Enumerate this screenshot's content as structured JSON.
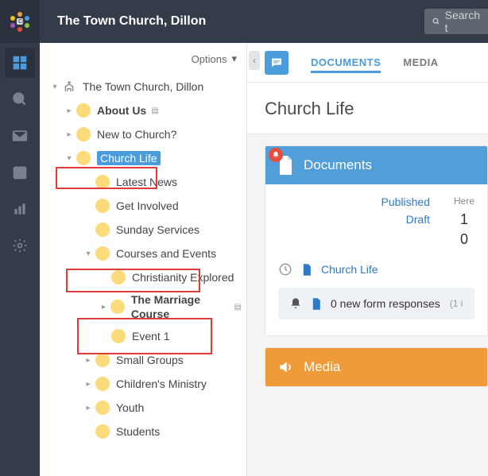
{
  "header": {
    "title": "The Town Church, Dillon",
    "search_placeholder": "Search t"
  },
  "sidebar": {
    "options_label": "Options",
    "root_label": "The Town Church, Dillon",
    "items": {
      "about": "About Us",
      "new": "New to Church?",
      "churchlife": "Church Life",
      "latest": "Latest News",
      "involved": "Get Involved",
      "sunday": "Sunday Services",
      "courses": "Courses and Events",
      "christianity": "Christianity Explored",
      "marriage": "The Marriage Course",
      "event1": "Event 1",
      "smallgroups": "Small Groups",
      "childrens": "Children's Ministry",
      "youth": "Youth",
      "students": "Students"
    }
  },
  "tabs": {
    "documents": "DOCUMENTS",
    "media": "MEDIA"
  },
  "page_title": "Church Life",
  "documents_panel": {
    "title": "Documents",
    "here_label": "Here",
    "published_label": "Published",
    "published_here": "1",
    "draft_label": "Draft",
    "draft_here": "0",
    "recent_item": "Church Life",
    "form_responses_text": "0 new form responses",
    "form_responses_muted": "(1 i"
  },
  "media_panel": {
    "title": "Media"
  },
  "colors": {
    "accent": "#4a9cdc",
    "orange": "#f09b3a",
    "folder": "#fdda7a",
    "highlight_red": "#e03b3b"
  }
}
